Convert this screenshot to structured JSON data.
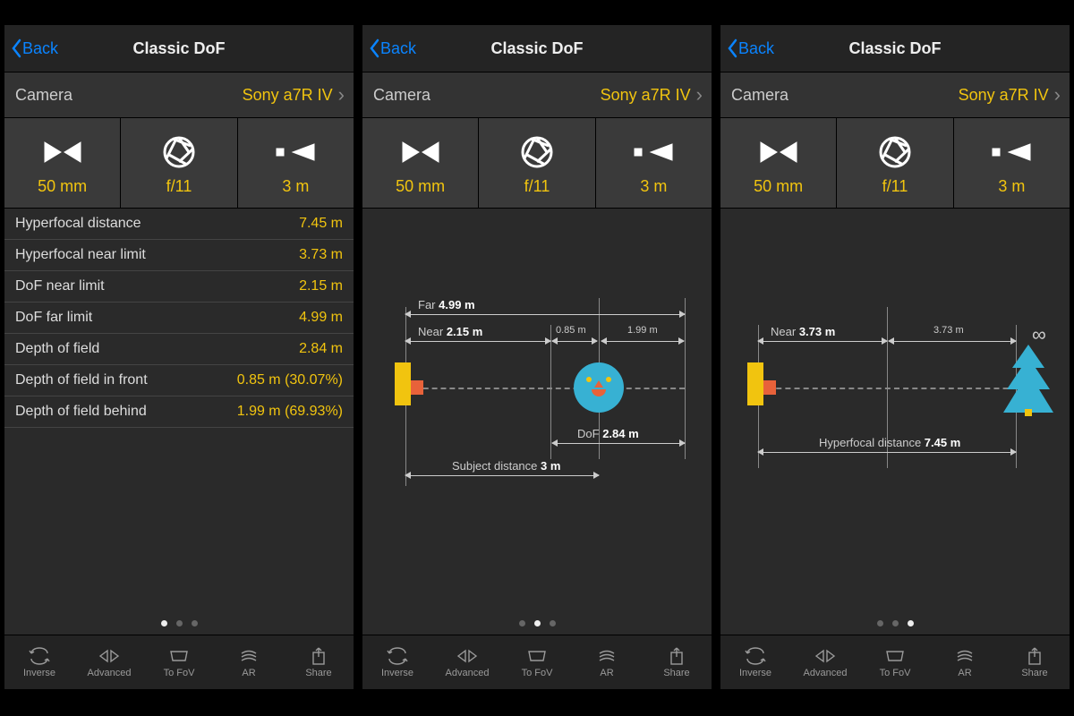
{
  "nav": {
    "back": "Back",
    "title": "Classic DoF"
  },
  "camera": {
    "label": "Camera",
    "value": "Sony a7R IV"
  },
  "params": {
    "focal": "50 mm",
    "aperture": "f/11",
    "distance": "3 m"
  },
  "results": [
    {
      "label": "Hyperfocal distance",
      "value": "7.45 m"
    },
    {
      "label": "Hyperfocal near limit",
      "value": "3.73 m"
    },
    {
      "label": "DoF near limit",
      "value": "2.15 m"
    },
    {
      "label": "DoF far limit",
      "value": "4.99 m"
    },
    {
      "label": "Depth of field",
      "value": "2.84 m"
    },
    {
      "label": "Depth of field in front",
      "value": "0.85 m (30.07%)"
    },
    {
      "label": "Depth of field behind",
      "value": "1.99 m (69.93%)"
    }
  ],
  "diagram2": {
    "far_label": "Far",
    "far_value": "4.99 m",
    "near_label": "Near",
    "near_value": "2.15 m",
    "front_value": "0.85 m",
    "behind_value": "1.99 m",
    "dof_label": "DoF",
    "dof_value": "2.84 m",
    "subj_label": "Subject distance",
    "subj_value": "3 m"
  },
  "diagram3": {
    "near_label": "Near",
    "near_value": "3.73 m",
    "half_value": "3.73 m",
    "infinity": "∞",
    "hyper_label": "Hyperfocal distance",
    "hyper_value": "7.45 m"
  },
  "tabs": [
    {
      "label": "Inverse"
    },
    {
      "label": "Advanced"
    },
    {
      "label": "To FoV"
    },
    {
      "label": "AR"
    },
    {
      "label": "Share"
    }
  ]
}
